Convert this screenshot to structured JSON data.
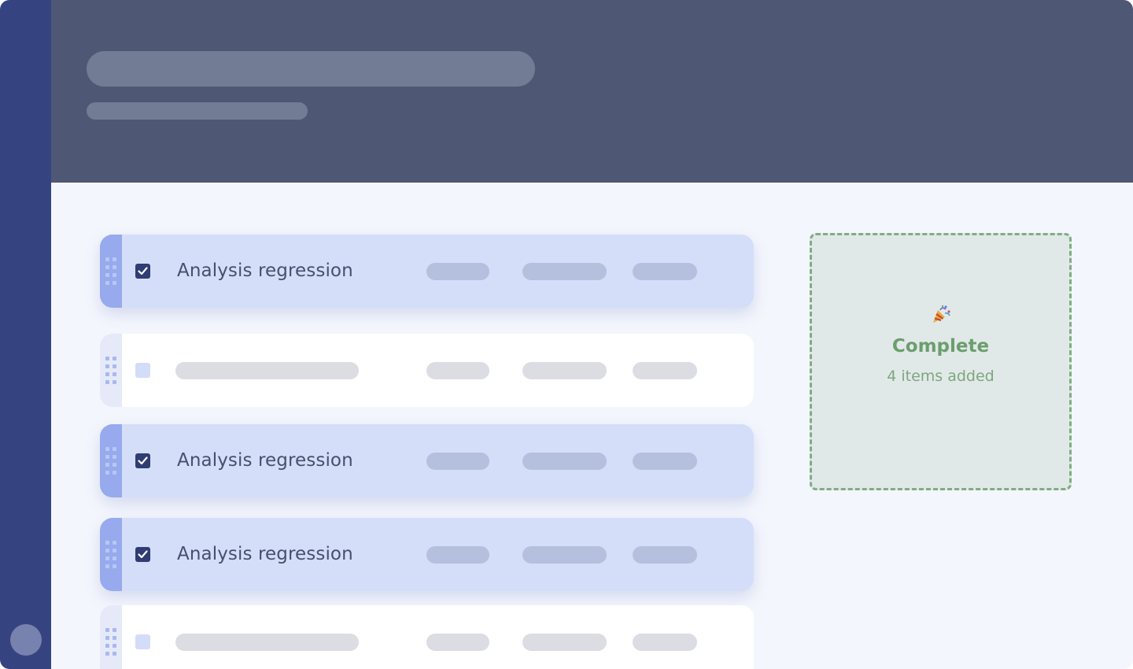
{
  "rows": [
    {
      "state": "checked",
      "label": "Analysis regression"
    },
    {
      "state": "placeholder",
      "label": ""
    },
    {
      "state": "checked",
      "label": "Analysis regression"
    },
    {
      "state": "checked",
      "label": "Analysis regression"
    },
    {
      "state": "placeholder",
      "label": ""
    }
  ],
  "drop_zone": {
    "icon": "party-popper-icon",
    "title": "Complete",
    "subtitle": "4 items added"
  },
  "colors": {
    "sidebar": "#354481",
    "header": "#4e5874",
    "checked_row": "#d5def8",
    "accent_green": "#6b9e6d"
  }
}
